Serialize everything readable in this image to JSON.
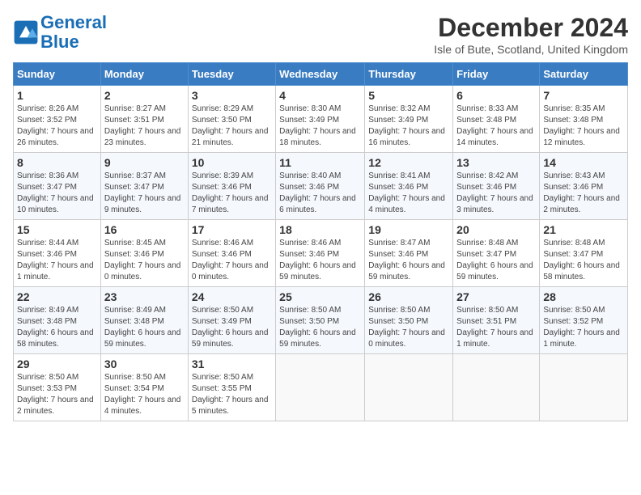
{
  "header": {
    "logo_line1": "General",
    "logo_line2": "Blue",
    "month_title": "December 2024",
    "subtitle": "Isle of Bute, Scotland, United Kingdom"
  },
  "weekdays": [
    "Sunday",
    "Monday",
    "Tuesday",
    "Wednesday",
    "Thursday",
    "Friday",
    "Saturday"
  ],
  "weeks": [
    [
      {
        "day": "1",
        "sunrise": "Sunrise: 8:26 AM",
        "sunset": "Sunset: 3:52 PM",
        "daylight": "Daylight: 7 hours and 26 minutes."
      },
      {
        "day": "2",
        "sunrise": "Sunrise: 8:27 AM",
        "sunset": "Sunset: 3:51 PM",
        "daylight": "Daylight: 7 hours and 23 minutes."
      },
      {
        "day": "3",
        "sunrise": "Sunrise: 8:29 AM",
        "sunset": "Sunset: 3:50 PM",
        "daylight": "Daylight: 7 hours and 21 minutes."
      },
      {
        "day": "4",
        "sunrise": "Sunrise: 8:30 AM",
        "sunset": "Sunset: 3:49 PM",
        "daylight": "Daylight: 7 hours and 18 minutes."
      },
      {
        "day": "5",
        "sunrise": "Sunrise: 8:32 AM",
        "sunset": "Sunset: 3:49 PM",
        "daylight": "Daylight: 7 hours and 16 minutes."
      },
      {
        "day": "6",
        "sunrise": "Sunrise: 8:33 AM",
        "sunset": "Sunset: 3:48 PM",
        "daylight": "Daylight: 7 hours and 14 minutes."
      },
      {
        "day": "7",
        "sunrise": "Sunrise: 8:35 AM",
        "sunset": "Sunset: 3:48 PM",
        "daylight": "Daylight: 7 hours and 12 minutes."
      }
    ],
    [
      {
        "day": "8",
        "sunrise": "Sunrise: 8:36 AM",
        "sunset": "Sunset: 3:47 PM",
        "daylight": "Daylight: 7 hours and 10 minutes."
      },
      {
        "day": "9",
        "sunrise": "Sunrise: 8:37 AM",
        "sunset": "Sunset: 3:47 PM",
        "daylight": "Daylight: 7 hours and 9 minutes."
      },
      {
        "day": "10",
        "sunrise": "Sunrise: 8:39 AM",
        "sunset": "Sunset: 3:46 PM",
        "daylight": "Daylight: 7 hours and 7 minutes."
      },
      {
        "day": "11",
        "sunrise": "Sunrise: 8:40 AM",
        "sunset": "Sunset: 3:46 PM",
        "daylight": "Daylight: 7 hours and 6 minutes."
      },
      {
        "day": "12",
        "sunrise": "Sunrise: 8:41 AM",
        "sunset": "Sunset: 3:46 PM",
        "daylight": "Daylight: 7 hours and 4 minutes."
      },
      {
        "day": "13",
        "sunrise": "Sunrise: 8:42 AM",
        "sunset": "Sunset: 3:46 PM",
        "daylight": "Daylight: 7 hours and 3 minutes."
      },
      {
        "day": "14",
        "sunrise": "Sunrise: 8:43 AM",
        "sunset": "Sunset: 3:46 PM",
        "daylight": "Daylight: 7 hours and 2 minutes."
      }
    ],
    [
      {
        "day": "15",
        "sunrise": "Sunrise: 8:44 AM",
        "sunset": "Sunset: 3:46 PM",
        "daylight": "Daylight: 7 hours and 1 minute."
      },
      {
        "day": "16",
        "sunrise": "Sunrise: 8:45 AM",
        "sunset": "Sunset: 3:46 PM",
        "daylight": "Daylight: 7 hours and 0 minutes."
      },
      {
        "day": "17",
        "sunrise": "Sunrise: 8:46 AM",
        "sunset": "Sunset: 3:46 PM",
        "daylight": "Daylight: 7 hours and 0 minutes."
      },
      {
        "day": "18",
        "sunrise": "Sunrise: 8:46 AM",
        "sunset": "Sunset: 3:46 PM",
        "daylight": "Daylight: 6 hours and 59 minutes."
      },
      {
        "day": "19",
        "sunrise": "Sunrise: 8:47 AM",
        "sunset": "Sunset: 3:46 PM",
        "daylight": "Daylight: 6 hours and 59 minutes."
      },
      {
        "day": "20",
        "sunrise": "Sunrise: 8:48 AM",
        "sunset": "Sunset: 3:47 PM",
        "daylight": "Daylight: 6 hours and 59 minutes."
      },
      {
        "day": "21",
        "sunrise": "Sunrise: 8:48 AM",
        "sunset": "Sunset: 3:47 PM",
        "daylight": "Daylight: 6 hours and 58 minutes."
      }
    ],
    [
      {
        "day": "22",
        "sunrise": "Sunrise: 8:49 AM",
        "sunset": "Sunset: 3:48 PM",
        "daylight": "Daylight: 6 hours and 58 minutes."
      },
      {
        "day": "23",
        "sunrise": "Sunrise: 8:49 AM",
        "sunset": "Sunset: 3:48 PM",
        "daylight": "Daylight: 6 hours and 59 minutes."
      },
      {
        "day": "24",
        "sunrise": "Sunrise: 8:50 AM",
        "sunset": "Sunset: 3:49 PM",
        "daylight": "Daylight: 6 hours and 59 minutes."
      },
      {
        "day": "25",
        "sunrise": "Sunrise: 8:50 AM",
        "sunset": "Sunset: 3:50 PM",
        "daylight": "Daylight: 6 hours and 59 minutes."
      },
      {
        "day": "26",
        "sunrise": "Sunrise: 8:50 AM",
        "sunset": "Sunset: 3:50 PM",
        "daylight": "Daylight: 7 hours and 0 minutes."
      },
      {
        "day": "27",
        "sunrise": "Sunrise: 8:50 AM",
        "sunset": "Sunset: 3:51 PM",
        "daylight": "Daylight: 7 hours and 1 minute."
      },
      {
        "day": "28",
        "sunrise": "Sunrise: 8:50 AM",
        "sunset": "Sunset: 3:52 PM",
        "daylight": "Daylight: 7 hours and 1 minute."
      }
    ],
    [
      {
        "day": "29",
        "sunrise": "Sunrise: 8:50 AM",
        "sunset": "Sunset: 3:53 PM",
        "daylight": "Daylight: 7 hours and 2 minutes."
      },
      {
        "day": "30",
        "sunrise": "Sunrise: 8:50 AM",
        "sunset": "Sunset: 3:54 PM",
        "daylight": "Daylight: 7 hours and 4 minutes."
      },
      {
        "day": "31",
        "sunrise": "Sunrise: 8:50 AM",
        "sunset": "Sunset: 3:55 PM",
        "daylight": "Daylight: 7 hours and 5 minutes."
      },
      null,
      null,
      null,
      null
    ]
  ]
}
